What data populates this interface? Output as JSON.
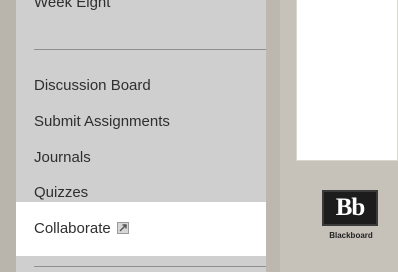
{
  "sidebar": {
    "week_label": "Week Eight",
    "items": [
      {
        "label": "Discussion Board"
      },
      {
        "label": "Submit Assignments"
      },
      {
        "label": "Journals"
      },
      {
        "label": "Quizzes"
      },
      {
        "label": "Collaborate",
        "icon": "external-link-icon",
        "selected": true
      }
    ]
  },
  "brand": {
    "logo_mark": "Bb",
    "logo_text": "Blackboard"
  },
  "colors": {
    "background": "#c9c5bd",
    "sidebar": "#cfcfcf",
    "selected_item": "#ffffff",
    "text": "#2f2f2f"
  }
}
